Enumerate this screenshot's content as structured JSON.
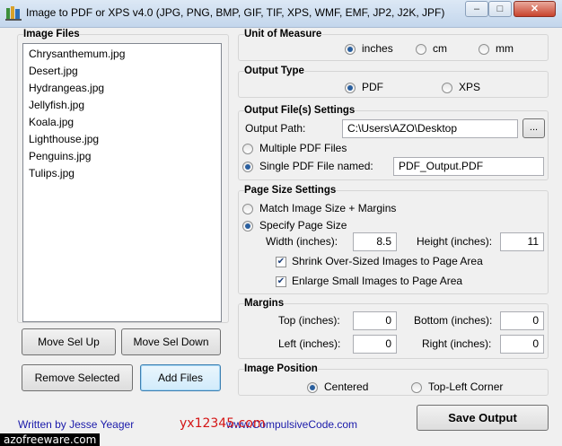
{
  "window": {
    "title": "Image to PDF or XPS  v4.0  (JPG, PNG, BMP, GIF, TIF, XPS, WMF, EMF, JP2, J2K, JPF)",
    "minimize": "–",
    "maximize": "□",
    "close": "✕"
  },
  "image_files": {
    "title": "Image Files",
    "items": [
      "Chrysanthemum.jpg",
      "Desert.jpg",
      "Hydrangeas.jpg",
      "Jellyfish.jpg",
      "Koala.jpg",
      "Lighthouse.jpg",
      "Penguins.jpg",
      "Tulips.jpg"
    ],
    "move_up": "Move Sel Up",
    "move_down": "Move Sel Down",
    "remove": "Remove Selected",
    "add": "Add Files"
  },
  "unit": {
    "title": "Unit of Measure",
    "inches": "inches",
    "cm": "cm",
    "mm": "mm",
    "selected": "inches"
  },
  "output_type": {
    "title": "Output Type",
    "pdf": "PDF",
    "xps": "XPS",
    "selected": "PDF"
  },
  "output_files": {
    "title": "Output File(s) Settings",
    "path_label": "Output Path:",
    "path_value": "C:\\Users\\AZO\\Desktop",
    "browse": "...",
    "multiple": "Multiple PDF Files",
    "single": "Single PDF File named:",
    "single_value": "PDF_Output.PDF",
    "selected": "single"
  },
  "page_size": {
    "title": "Page Size Settings",
    "match": "Match Image Size + Margins",
    "specify": "Specify Page Size",
    "width_label": "Width (inches):",
    "width_value": "8.5",
    "height_label": "Height (inches):",
    "height_value": "11",
    "shrink": "Shrink Over-Sized Images to Page Area",
    "enlarge": "Enlarge Small Images to Page Area",
    "selected": "specify",
    "shrink_checked": true,
    "enlarge_checked": true
  },
  "margins": {
    "title": "Margins",
    "top_label": "Top (inches):",
    "top_value": "0",
    "bottom_label": "Bottom (inches):",
    "bottom_value": "0",
    "left_label": "Left (inches):",
    "left_value": "0",
    "right_label": "Right (inches):",
    "right_value": "0"
  },
  "image_position": {
    "title": "Image Position",
    "centered": "Centered",
    "topleft": "Top-Left Corner",
    "selected": "centered"
  },
  "footer": {
    "author": "Written by Jesse Yeager",
    "site": "www.CompulsiveCode.com",
    "save": "Save Output",
    "watermark_url": "azofreeware.com",
    "watermark_red": "yx12345.com"
  },
  "colors": {
    "link": "#1a1aaa",
    "watermark_red": "#d41414"
  }
}
